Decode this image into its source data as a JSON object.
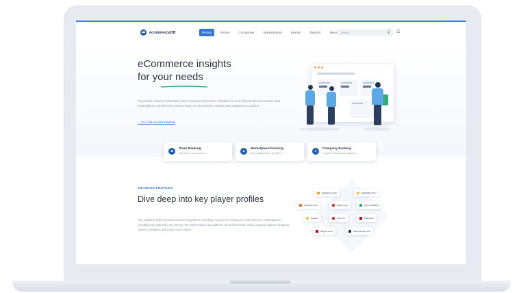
{
  "nav": {
    "logo": "ecommerceDB",
    "items": [
      "Pricing",
      "Stores",
      "Companies",
      "Marketplaces",
      "Brands",
      "Reports",
      "News"
    ],
    "active_index": 0,
    "search_placeholder": "Search"
  },
  "hero": {
    "title_line1": "eCommerce insights",
    "title_line2": "for your needs",
    "description": "We provide extensive information and crucial key performance indicators for more than 30,000 online stores and marketplaces. See the most relevant figures of eCommerce markets and companies at a glance.",
    "link": "Go to all our data solutions"
  },
  "tabs": [
    {
      "title": "Store Ranking",
      "subtitle": "Top stores by revenue →",
      "icon": "store-icon"
    },
    {
      "title": "Marketplace Ranking",
      "subtitle": "Top marketplaces by GMV →",
      "icon": "marketplace-icon"
    },
    {
      "title": "Company Ranking",
      "subtitle": "Largest eCommerce players →",
      "icon": "company-icon"
    }
  ],
  "section2": {
    "kicker": "DETAILED PROFILES",
    "title": "Dive deep into key player profiles",
    "description": "The detailed profiles provide relevant insights for a strategic analysis of companies in the stores or marketplaces, including key data such as revenue, the market share and platform, as well as social media, payment options, shipping service providers, and many more metrics."
  },
  "profiles": [
    {
      "label": "amazon.com",
      "color": "#f29b1a"
    },
    {
      "label": "walmart.com",
      "color": "#f6c343"
    },
    {
      "label": "alibaba.com",
      "color": "#f36c21"
    },
    {
      "label": "ebay.com",
      "color": "#e53238"
    },
    {
      "label": "mercadolibre",
      "color": "#2fae74"
    },
    {
      "label": "flipkart",
      "color": "#f6c343"
    },
    {
      "label": "Jd.com",
      "color": "#e53238"
    },
    {
      "label": "Rakuten",
      "color": "#bf0000"
    },
    {
      "label": "target.com",
      "color": "#cc0000"
    },
    {
      "label": "ebay.com",
      "color": "#6b7789"
    },
    {
      "label": "aliexpress.com",
      "color": "#2a3446"
    }
  ],
  "colors": {
    "accent": "#2f78d6",
    "brand": "#1f5fb4",
    "underline": "#2fae74"
  }
}
